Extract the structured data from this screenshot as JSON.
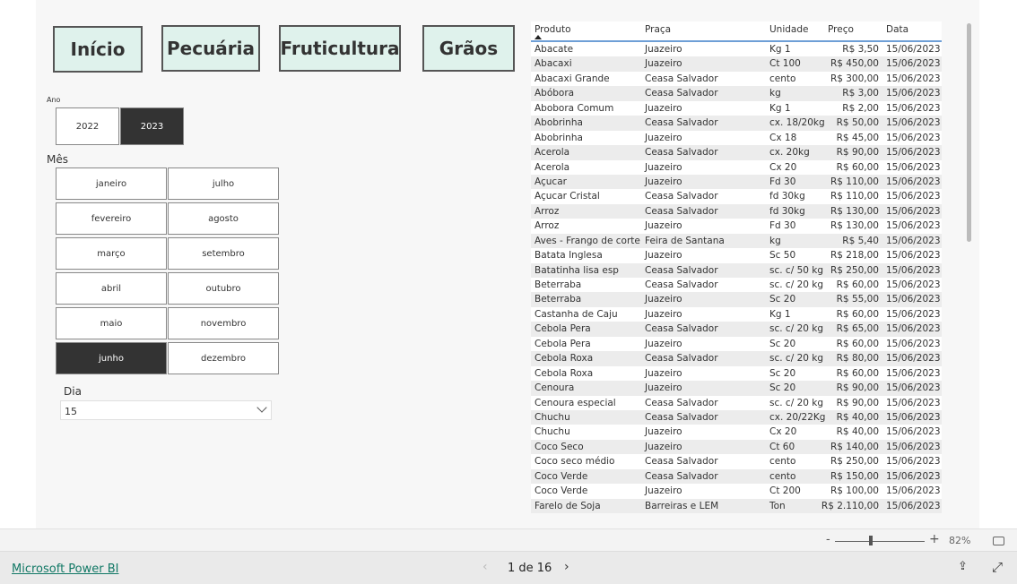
{
  "nav": [
    "Início",
    "Pecuária",
    "Fruticultura",
    "Grãos"
  ],
  "ano": {
    "label": "Ano",
    "options": [
      "2022",
      "2023"
    ],
    "selected": "2023"
  },
  "mes": {
    "label": "Mês",
    "options": [
      "janeiro",
      "julho",
      "fevereiro",
      "agosto",
      "março",
      "setembro",
      "abril",
      "outubro",
      "maio",
      "novembro",
      "junho",
      "dezembro"
    ],
    "selected": "junho"
  },
  "dia": {
    "label": "Dia",
    "value": "15"
  },
  "table": {
    "columns": [
      "Produto",
      "Praça",
      "Unidade",
      "Preço",
      "Data"
    ],
    "sort": "Produto ascending",
    "rows": [
      [
        "Abacate",
        "Juazeiro",
        "Kg 1",
        "R$ 3,50",
        "15/06/2023"
      ],
      [
        "Abacaxi",
        "Juazeiro",
        "Ct 100",
        "R$ 450,00",
        "15/06/2023"
      ],
      [
        "Abacaxi Grande",
        "Ceasa Salvador",
        "cento",
        "R$ 300,00",
        "15/06/2023"
      ],
      [
        "Abóbora",
        "Ceasa Salvador",
        "kg",
        "R$ 3,00",
        "15/06/2023"
      ],
      [
        "Abobora Comum",
        "Juazeiro",
        "Kg 1",
        "R$ 2,00",
        "15/06/2023"
      ],
      [
        "Abobrinha",
        "Ceasa Salvador",
        "cx. 18/20kg",
        "R$ 50,00",
        "15/06/2023"
      ],
      [
        "Abobrinha",
        "Juazeiro",
        "Cx 18",
        "R$ 45,00",
        "15/06/2023"
      ],
      [
        "Acerola",
        "Ceasa Salvador",
        "cx. 20kg",
        "R$ 90,00",
        "15/06/2023"
      ],
      [
        "Acerola",
        "Juazeiro",
        "Cx 20",
        "R$ 60,00",
        "15/06/2023"
      ],
      [
        "Açucar",
        "Juazeiro",
        "Fd 30",
        "R$ 110,00",
        "15/06/2023"
      ],
      [
        "Açucar Cristal",
        "Ceasa Salvador",
        "fd 30kg",
        "R$ 110,00",
        "15/06/2023"
      ],
      [
        "Arroz",
        "Ceasa Salvador",
        "fd 30kg",
        "R$ 130,00",
        "15/06/2023"
      ],
      [
        "Arroz",
        "Juazeiro",
        "Fd 30",
        "R$ 130,00",
        "15/06/2023"
      ],
      [
        "Aves - Frango de corte",
        "Feira de Santana",
        "kg",
        "R$ 5,40",
        "15/06/2023"
      ],
      [
        "Batata Inglesa",
        "Juazeiro",
        "Sc 50",
        "R$ 218,00",
        "15/06/2023"
      ],
      [
        "Batatinha lisa esp",
        "Ceasa Salvador",
        "sc. c/ 50 kg",
        "R$ 250,00",
        "15/06/2023"
      ],
      [
        "Beterraba",
        "Ceasa Salvador",
        "sc. c/ 20 kg",
        "R$ 60,00",
        "15/06/2023"
      ],
      [
        "Beterraba",
        "Juazeiro",
        "Sc 20",
        "R$ 55,00",
        "15/06/2023"
      ],
      [
        "Castanha de Caju",
        "Juazeiro",
        "Kg 1",
        "R$ 60,00",
        "15/06/2023"
      ],
      [
        "Cebola Pera",
        "Ceasa Salvador",
        "sc. c/ 20 kg",
        "R$ 65,00",
        "15/06/2023"
      ],
      [
        "Cebola Pera",
        "Juazeiro",
        "Sc 20",
        "R$ 60,00",
        "15/06/2023"
      ],
      [
        "Cebola Roxa",
        "Ceasa Salvador",
        "sc. c/ 20 kg",
        "R$ 80,00",
        "15/06/2023"
      ],
      [
        "Cebola Roxa",
        "Juazeiro",
        "Sc 20",
        "R$ 60,00",
        "15/06/2023"
      ],
      [
        "Cenoura",
        "Juazeiro",
        "Sc 20",
        "R$ 90,00",
        "15/06/2023"
      ],
      [
        "Cenoura especial",
        "Ceasa Salvador",
        "sc. c/ 20 kg",
        "R$ 90,00",
        "15/06/2023"
      ],
      [
        "Chuchu",
        "Ceasa Salvador",
        "cx. 20/22Kg",
        "R$ 40,00",
        "15/06/2023"
      ],
      [
        "Chuchu",
        "Juazeiro",
        "Cx 20",
        "R$ 40,00",
        "15/06/2023"
      ],
      [
        "Coco Seco",
        "Juazeiro",
        "Ct 60",
        "R$ 140,00",
        "15/06/2023"
      ],
      [
        "Coco seco médio",
        "Ceasa Salvador",
        "cento",
        "R$ 250,00",
        "15/06/2023"
      ],
      [
        "Coco Verde",
        "Ceasa Salvador",
        "cento",
        "R$ 150,00",
        "15/06/2023"
      ],
      [
        "Coco Verde",
        "Juazeiro",
        "Ct 200",
        "R$ 100,00",
        "15/06/2023"
      ],
      [
        "Farelo de Soja",
        "Barreiras e LEM",
        "Ton",
        "R$ 2.110,00",
        "15/06/2023"
      ]
    ]
  },
  "zoom": {
    "minus": "-",
    "plus": "+",
    "value": "82%",
    "level_percent": 82
  },
  "footer": {
    "brand_link": "Microsoft Power BI",
    "page": "1 de 16"
  }
}
